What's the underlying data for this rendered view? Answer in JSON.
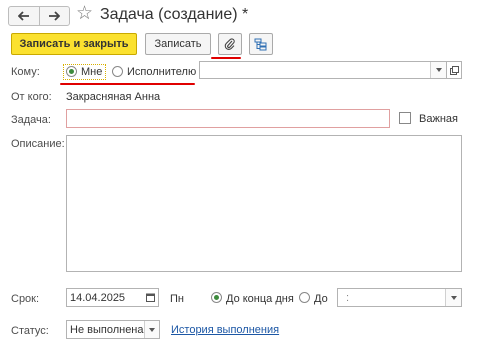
{
  "window": {
    "title": "Задача (создание) *",
    "back_icon": "arrow-left-icon",
    "forward_icon": "arrow-right-icon",
    "favorite_icon": "star-icon"
  },
  "toolbar": {
    "save_close_label": "Записать и закрыть",
    "save_label": "Записать",
    "attach_icon": "paperclip-icon",
    "structure_icon": "hierarchy-icon"
  },
  "form": {
    "to_label": "Кому:",
    "to_options": [
      "Мне",
      "Исполнителю"
    ],
    "to_selected": "Мне",
    "to_value": "",
    "from_label": "От кого:",
    "from_value": "Закрасняная Анна",
    "task_label": "Задача:",
    "task_value": "",
    "important_label": "Важная",
    "important_checked": false,
    "description_label": "Описание:",
    "description_value": "",
    "deadline_label": "Срок:",
    "deadline_date": "14.04.2025",
    "deadline_weekday": "Пн",
    "deadline_options": [
      "До конца дня",
      "До"
    ],
    "deadline_selected": "До конца дня",
    "deadline_time": ":",
    "status_label": "Статус:",
    "status_value": "Не выполнена",
    "history_link": "История выполнения"
  },
  "colors": {
    "primary_button": "#fbe12f",
    "annotation_red": "#e00000",
    "link": "#1c57a5",
    "radio_selected": "#3d8b3d"
  }
}
